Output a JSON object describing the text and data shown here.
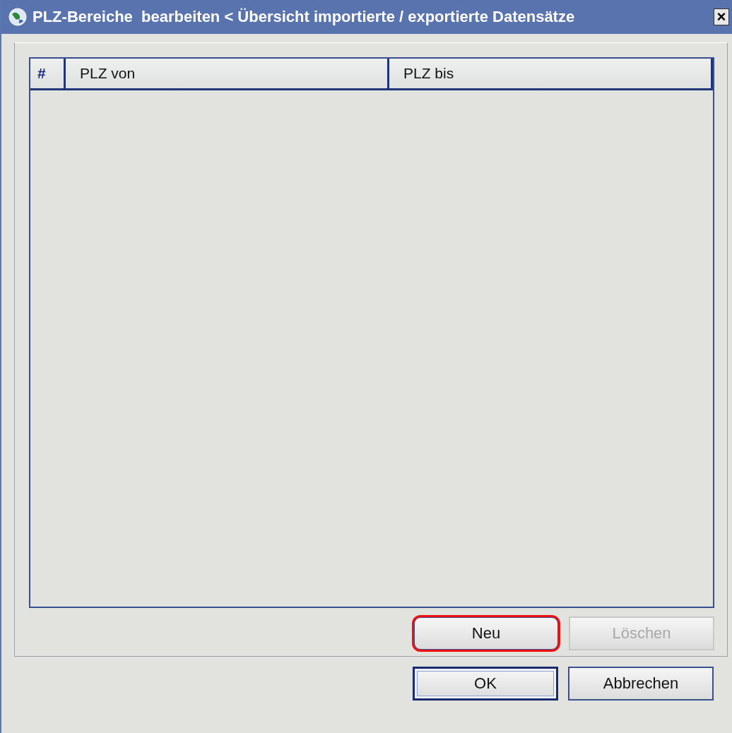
{
  "window": {
    "title": "PLZ-Bereiche  bearbeiten < Übersicht importierte / exportierte Datensätze",
    "close": "×"
  },
  "table": {
    "columns": [
      "#",
      "PLZ von",
      "PLZ bis"
    ]
  },
  "panel_buttons": [
    {
      "label": "Neu",
      "disabled": false,
      "highlighted": true
    },
    {
      "label": "Löschen",
      "disabled": true,
      "highlighted": false
    }
  ],
  "dialog_buttons": [
    {
      "label": "OK",
      "focused": true
    },
    {
      "label": "Abbrechen",
      "focused": false
    }
  ]
}
